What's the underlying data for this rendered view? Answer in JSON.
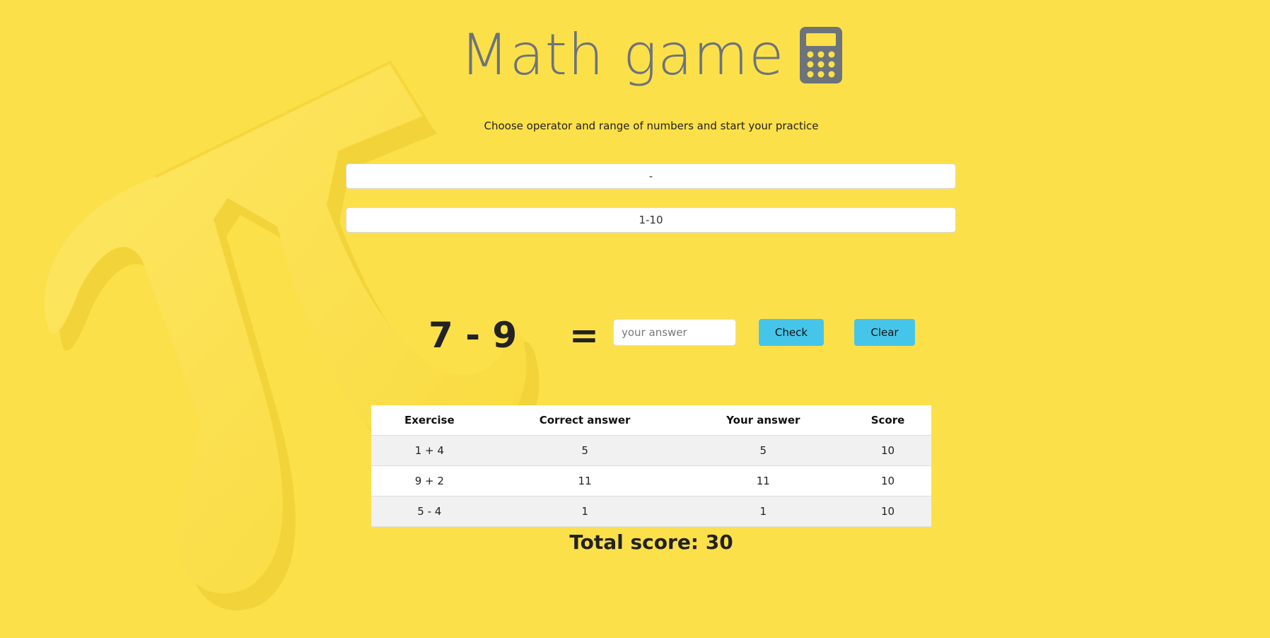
{
  "page": {
    "title": "Math game",
    "title_icon": "calculator-icon",
    "subtitle": "Choose operator and range of numbers and start your practice",
    "background_color": "#fce04a"
  },
  "controls": {
    "operator_value": "-",
    "range_value": "1-10"
  },
  "exercise": {
    "current": "7 - 9",
    "equals": "=",
    "answer_placeholder": "your answer",
    "check_label": "Check",
    "clear_label": "Clear",
    "button_color": "#46c5ea"
  },
  "results": {
    "headers": [
      "Exercise",
      "Correct answer",
      "Your answer",
      "Score"
    ],
    "rows": [
      {
        "exercise": "1 + 4",
        "correct": "5",
        "yours": "5",
        "score": "10"
      },
      {
        "exercise": "9 + 2",
        "correct": "11",
        "yours": "11",
        "score": "10"
      },
      {
        "exercise": "5 - 4",
        "correct": "1",
        "yours": "1",
        "score": "10"
      }
    ]
  },
  "total": {
    "text": "Total score: 30"
  }
}
